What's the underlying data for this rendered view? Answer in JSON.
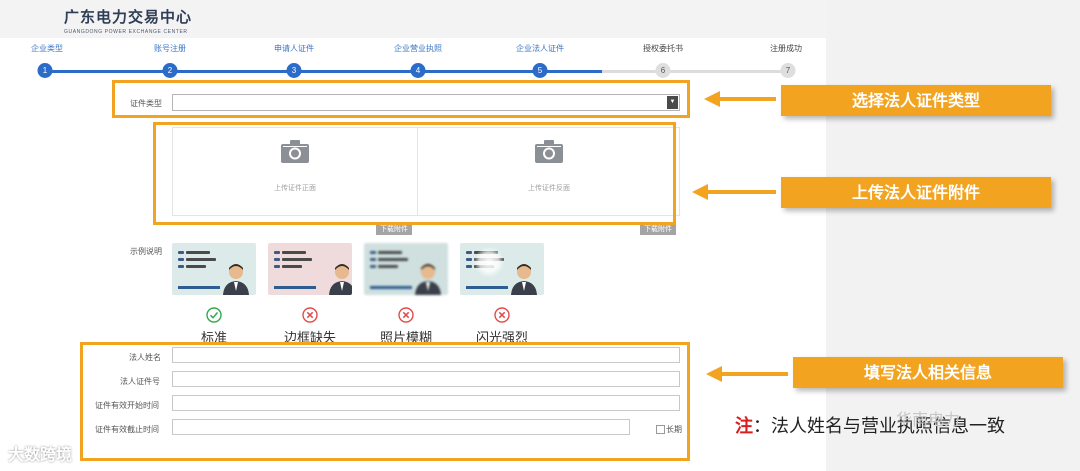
{
  "logo": {
    "name_cn": "广东电力交易中心",
    "name_en": "GUANGDONG POWER EXCHANGE CENTER"
  },
  "steps": [
    {
      "label": "企业类型",
      "number": "1"
    },
    {
      "label": "账号注册",
      "number": "2"
    },
    {
      "label": "申请人证件",
      "number": "3"
    },
    {
      "label": "企业营业执照",
      "number": "4"
    },
    {
      "label": "企业法人证件",
      "number": "5"
    },
    {
      "label": "授权委托书",
      "number": "6"
    },
    {
      "label": "注册成功",
      "number": "7"
    }
  ],
  "current_step": 5,
  "form": {
    "id_type_label": "证件类型",
    "id_type_value": "",
    "upload_front": "上传证件正面",
    "upload_back": "上传证件反面",
    "download_label": "下载附件",
    "example_label": "示例说明",
    "samples": [
      "标准",
      "边框缺失",
      "照片模糊",
      "闪光强烈"
    ],
    "sample_status": [
      "ok",
      "error",
      "error",
      "error"
    ],
    "name_label": "法人姓名",
    "id_number_label": "法人证件号",
    "valid_start_label": "证件有效开始时间",
    "valid_end_label": "证件有效截止时间",
    "long_term_label": "长期"
  },
  "callouts": {
    "select_type": "选择法人证件类型",
    "upload_attachment": "上传法人证件附件",
    "fill_info": "填写法人相关信息"
  },
  "note": {
    "prefix": "注",
    "text": "：法人姓名与营业执照信息一致"
  },
  "watermarks": {
    "left": "大数跨境",
    "right": "华南电力"
  },
  "colors": {
    "accent": "#f2a320",
    "step_active": "#2b6cc8",
    "ok": "#2fa84f",
    "error": "#e24a4a"
  }
}
